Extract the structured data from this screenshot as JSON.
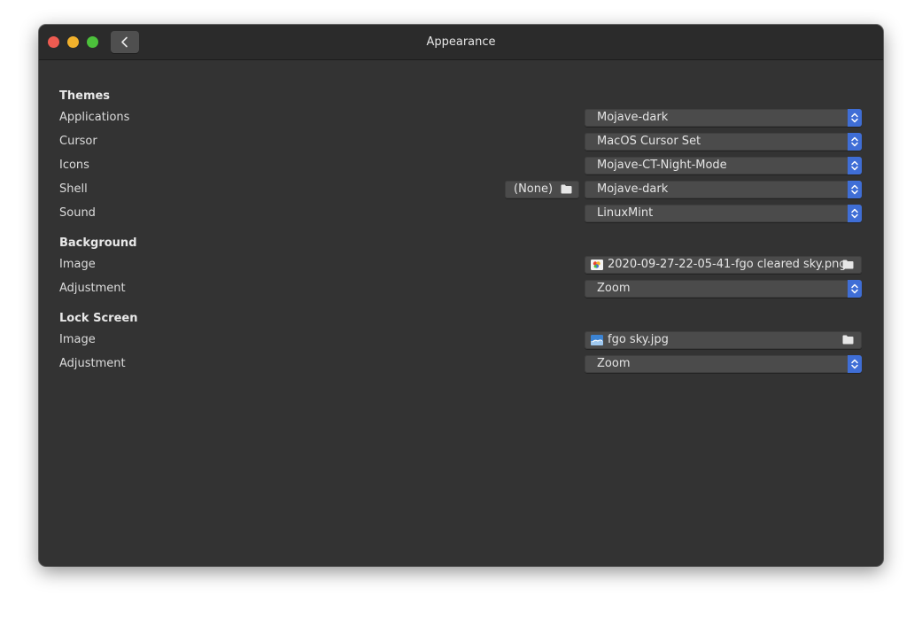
{
  "window": {
    "title": "Appearance"
  },
  "themes": {
    "heading": "Themes",
    "rows": [
      {
        "label": "Applications",
        "value": "Mojave-dark"
      },
      {
        "label": "Cursor",
        "value": "MacOS Cursor Set"
      },
      {
        "label": "Icons",
        "value": "Mojave-CT-Night-Mode"
      },
      {
        "label": "Shell",
        "value": "Mojave-dark",
        "file_button": "(None)"
      },
      {
        "label": "Sound",
        "value": "LinuxMint"
      }
    ]
  },
  "background": {
    "heading": "Background",
    "image_label": "Image",
    "image_file": "2020-09-27-22-05-41-fgo cleared sky.png",
    "adjustment_label": "Adjustment",
    "adjustment_value": "Zoom"
  },
  "lock_screen": {
    "heading": "Lock Screen",
    "image_label": "Image",
    "image_file": "fgo sky.jpg",
    "adjustment_label": "Adjustment",
    "adjustment_value": "Zoom"
  },
  "icons": {
    "back": "chevron-left-icon",
    "combo_arrow": "up-down-chevron-icon",
    "folder": "folder-icon"
  },
  "colors": {
    "window_bg": "#333333",
    "accent": "#3f6ed6",
    "close": "#ee5b51",
    "minimize": "#f1b12c",
    "maximize": "#4cc13b"
  }
}
